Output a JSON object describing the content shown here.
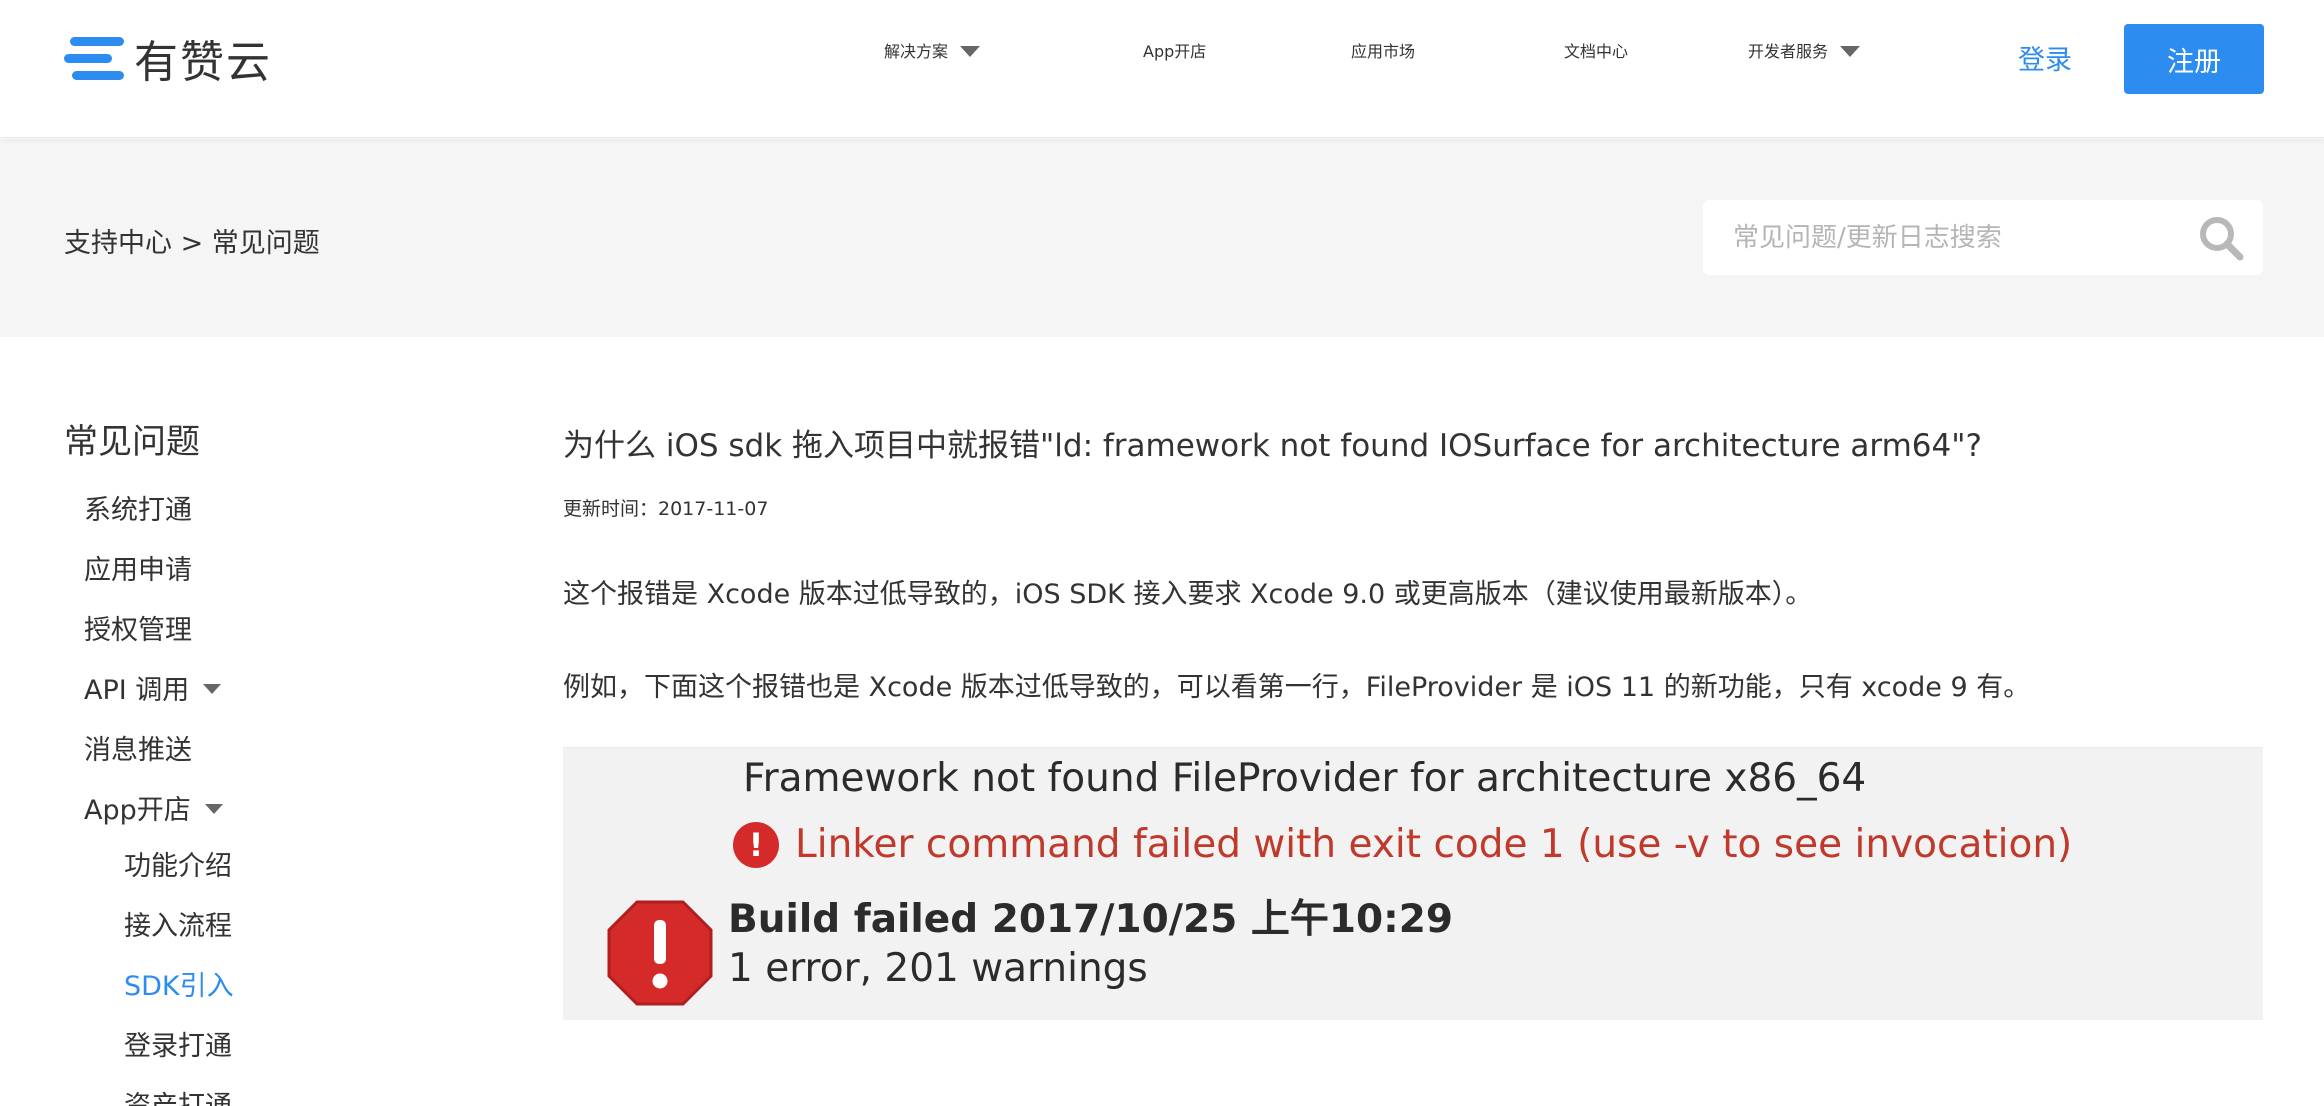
{
  "header": {
    "logo_text": "有赞云",
    "nav": [
      {
        "label": "解决方案",
        "has_dropdown": true
      },
      {
        "label": "App开店",
        "has_dropdown": false
      },
      {
        "label": "应用市场",
        "has_dropdown": false
      },
      {
        "label": "文档中心",
        "has_dropdown": false
      },
      {
        "label": "开发者服务",
        "has_dropdown": true
      }
    ],
    "login_label": "登录",
    "register_label": "注册"
  },
  "band": {
    "breadcrumb": "支持中心 > 常见问题",
    "search_placeholder": "常见问题/更新日志搜索"
  },
  "sidebar": {
    "title": "常见问题",
    "items": [
      {
        "label": "系统打通",
        "level": 1
      },
      {
        "label": "应用申请",
        "level": 1
      },
      {
        "label": "授权管理",
        "level": 1
      },
      {
        "label": "API 调用",
        "level": 1,
        "has_dropdown": true
      },
      {
        "label": "消息推送",
        "level": 1
      },
      {
        "label": "App开店",
        "level": 1,
        "has_dropdown": true
      },
      {
        "label": "功能介绍",
        "level": 2
      },
      {
        "label": "接入流程",
        "level": 2
      },
      {
        "label": "SDK引入",
        "level": 2,
        "active": true
      },
      {
        "label": "登录打通",
        "level": 2
      },
      {
        "label": "资产打通",
        "level": 2
      }
    ]
  },
  "article": {
    "title": "为什么 iOS sdk 拖入项目中就报错\"ld: framework not found IOSurface for architecture arm64\"?",
    "updated": "更新时间：2017-11-07",
    "paragraphs": [
      "这个报错是 Xcode 版本过低导致的，iOS SDK 接入要求 Xcode 9.0 或更高版本（建议使用最新版本）。",
      "例如，下面这个报错也是 Xcode 版本过低导致的，可以看第一行，FileProvider 是 iOS 11 的新功能，只有 xcode 9 有。"
    ],
    "screenshot": {
      "line1": "Framework not found FileProvider for architecture x86_64",
      "line2": "Linker command failed with exit code 1 (use -v to see invocation)",
      "line3": "Build failed    2017/10/25 上午10:29",
      "line4": "1 error, 201 warnings"
    }
  },
  "colors": {
    "accent": "#2d8cf0",
    "band_bg": "#f5f5f5",
    "error_red": "#d42a2a"
  }
}
